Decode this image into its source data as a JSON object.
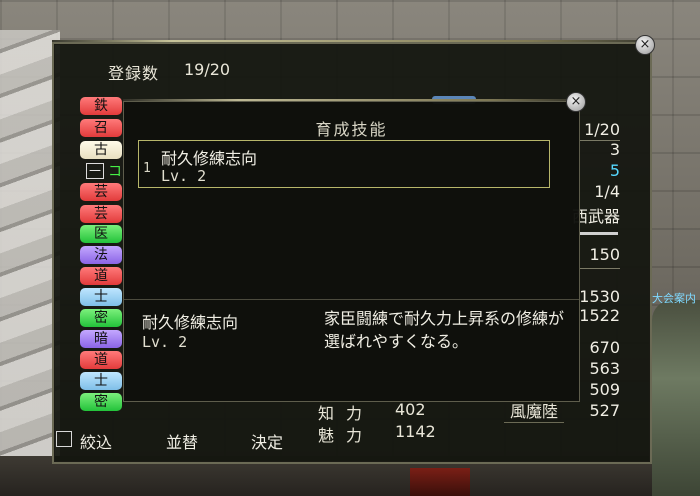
{
  "header": {
    "registered_label": "登録数",
    "registered_value": "19/20"
  },
  "tags": [
    {
      "text": "鉄",
      "color": "red"
    },
    {
      "text": "召",
      "color": "red"
    },
    {
      "text": "古",
      "color": "cream"
    },
    {
      "text": "芸",
      "color": "red"
    },
    {
      "text": "芸",
      "color": "red"
    },
    {
      "text": "医",
      "color": "green"
    },
    {
      "text": "法",
      "color": "purple"
    },
    {
      "text": "道",
      "color": "red"
    },
    {
      "text": "士",
      "color": "blue"
    },
    {
      "text": "密",
      "color": "green"
    },
    {
      "text": "暗",
      "color": "purple"
    },
    {
      "text": "道",
      "color": "red"
    },
    {
      "text": "士",
      "color": "blue"
    },
    {
      "text": "密",
      "color": "green"
    }
  ],
  "tag_checkbox_glyph": "—",
  "tag_side_text": "コ",
  "right_column": {
    "v1": "1/20",
    "v2": "3",
    "v3": "5",
    "v4": "1/4",
    "v5": "西武器",
    "v6": "150",
    "v7": "1530",
    "v8": "1522",
    "v9": "670",
    "v10": "563",
    "v11": "509",
    "v12": "527"
  },
  "bottom_stats": [
    {
      "label": "知力",
      "value": "402"
    },
    {
      "label": "魅力",
      "value": "1142"
    }
  ],
  "faction": "風魔陸",
  "footer": {
    "filter": "絞込",
    "sort": "並替",
    "confirm": "決定"
  },
  "dialog": {
    "title": "育成技能",
    "skill_index": "1",
    "skill_name": "耐久修練志向",
    "skill_level": "Lv. 2",
    "detail_name": "耐久修練志向",
    "detail_level": "Lv. 2",
    "detail_description": "家臣闘練で耐久力上昇系の修練が選ばれやすくなる。"
  },
  "background_label": "大会案内",
  "colors": {
    "accent_cyan": "#56d8ff",
    "skill_box_border": "#b7b66a"
  }
}
